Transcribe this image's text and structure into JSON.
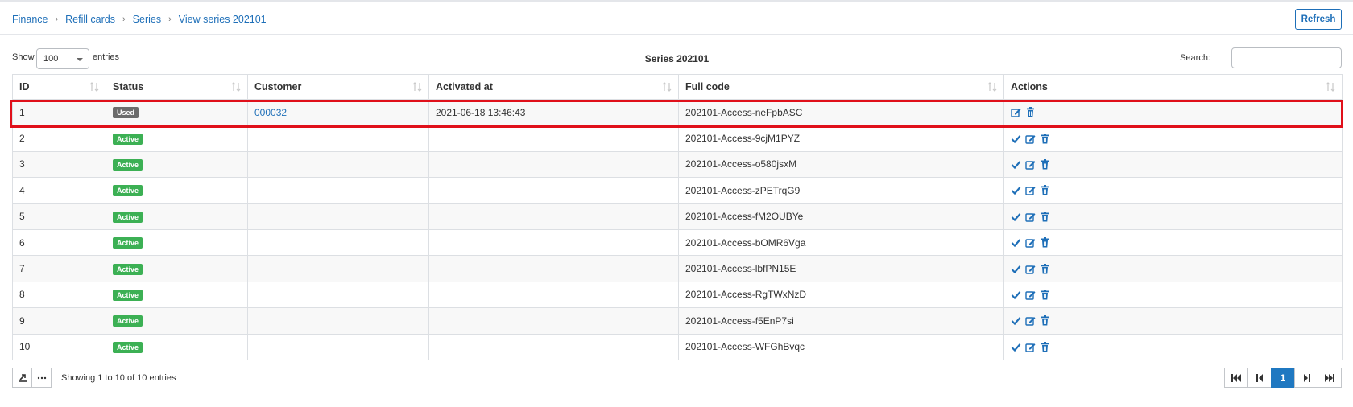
{
  "breadcrumb": [
    "Finance",
    "Refill cards",
    "Series",
    "View series 202101"
  ],
  "refresh_label": "Refresh",
  "controls": {
    "show_label": "Show",
    "entries_value": "100",
    "entries_label": "entries",
    "title": "Series 202101",
    "search_label": "Search:"
  },
  "columns": [
    "ID",
    "Status",
    "Customer",
    "Activated at",
    "Full code",
    "Actions"
  ],
  "rows": [
    {
      "id": "1",
      "status": "Used",
      "customer": "000032",
      "activated_at": "2021-06-18 13:46:43",
      "full_code": "202101-Access-neFpbASC"
    },
    {
      "id": "2",
      "status": "Active",
      "customer": "",
      "activated_at": "",
      "full_code": "202101-Access-9cjM1PYZ"
    },
    {
      "id": "3",
      "status": "Active",
      "customer": "",
      "activated_at": "",
      "full_code": "202101-Access-o580jsxM"
    },
    {
      "id": "4",
      "status": "Active",
      "customer": "",
      "activated_at": "",
      "full_code": "202101-Access-zPETrqG9"
    },
    {
      "id": "5",
      "status": "Active",
      "customer": "",
      "activated_at": "",
      "full_code": "202101-Access-fM2OUBYe"
    },
    {
      "id": "6",
      "status": "Active",
      "customer": "",
      "activated_at": "",
      "full_code": "202101-Access-bOMR6Vga"
    },
    {
      "id": "7",
      "status": "Active",
      "customer": "",
      "activated_at": "",
      "full_code": "202101-Access-lbfPN15E"
    },
    {
      "id": "8",
      "status": "Active",
      "customer": "",
      "activated_at": "",
      "full_code": "202101-Access-RgTWxNzD"
    },
    {
      "id": "9",
      "status": "Active",
      "customer": "",
      "activated_at": "",
      "full_code": "202101-Access-f5EnP7si"
    },
    {
      "id": "10",
      "status": "Active",
      "customer": "",
      "activated_at": "",
      "full_code": "202101-Access-WFGhBvqc"
    }
  ],
  "footer": {
    "info": "Showing 1 to 10 of 10 entries",
    "current_page": "1"
  },
  "colors": {
    "link": "#1e6fb8",
    "active_badge": "#3cb054",
    "used_badge": "#6c6c6c",
    "highlight": "#e0101a",
    "pager_current": "#1f78c1"
  },
  "icons": {
    "activate": "check-icon",
    "edit": "edit-icon",
    "delete": "trash-icon",
    "export": "export-icon",
    "more": "more-icon"
  }
}
